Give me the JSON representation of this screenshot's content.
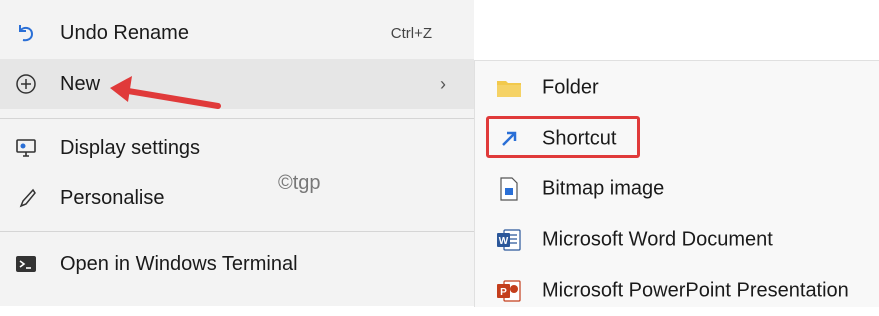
{
  "menu": {
    "items": [
      {
        "label": "Undo Rename",
        "shortcut": "Ctrl+Z",
        "icon": "undo-icon"
      },
      {
        "label": "New",
        "submenu_indicator": "›",
        "icon": "plus-circle-icon"
      },
      {
        "label": "Display settings",
        "icon": "display-settings-icon"
      },
      {
        "label": "Personalise",
        "icon": "brush-icon"
      },
      {
        "label": "Open in Windows Terminal",
        "icon": "terminal-icon"
      }
    ]
  },
  "submenu": {
    "items": [
      {
        "label": "Folder",
        "icon": "folder-icon"
      },
      {
        "label": "Shortcut",
        "icon": "shortcut-icon"
      },
      {
        "label": "Bitmap image",
        "icon": "bitmap-icon"
      },
      {
        "label": "Microsoft Word Document",
        "icon": "word-icon"
      },
      {
        "label": "Microsoft PowerPoint Presentation",
        "icon": "powerpoint-icon"
      }
    ]
  },
  "watermark": "©tgp",
  "colors": {
    "annotation_red": "#e03a3a",
    "menu_bg": "#f3f3f3",
    "hover_bg": "#e6e6e6",
    "accent_blue": "#2a6fd6"
  }
}
